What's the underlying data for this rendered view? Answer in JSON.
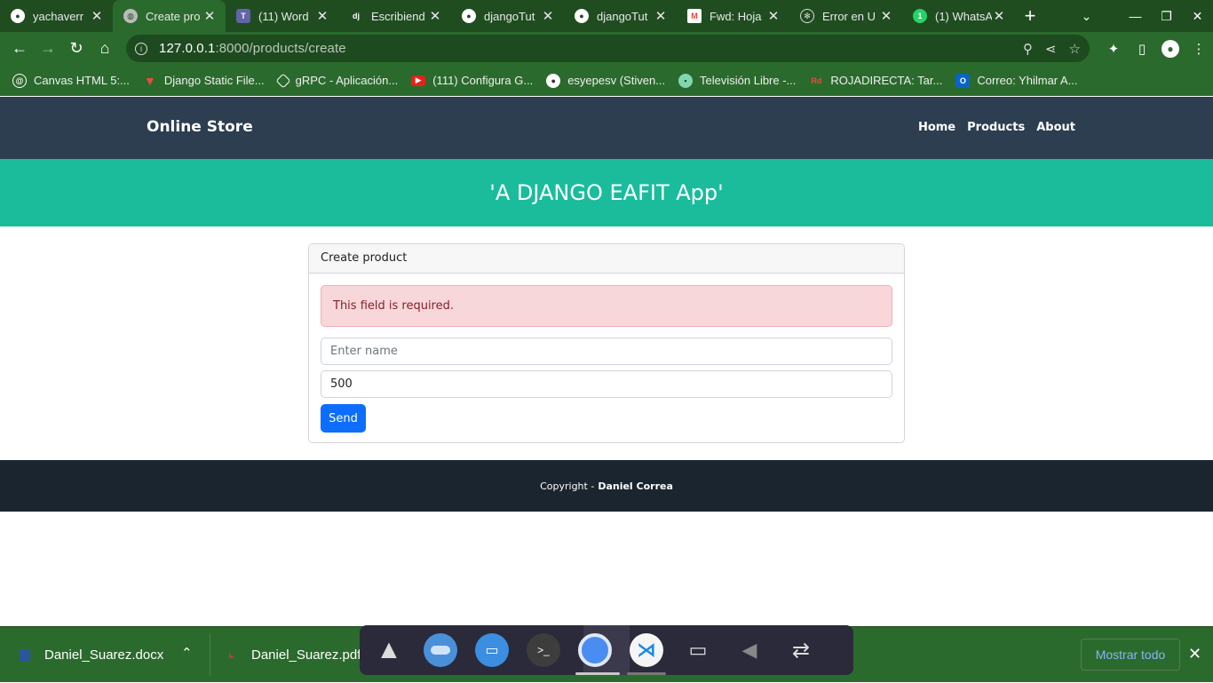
{
  "browser": {
    "tabs": [
      {
        "title": "yachaverr",
        "favicon": "github-icon",
        "active": false
      },
      {
        "title": "Create pro",
        "favicon": "globe-icon",
        "active": true
      },
      {
        "title": "(11) Word",
        "favicon": "teams-icon",
        "active": false
      },
      {
        "title": "Escribiend",
        "favicon": "django-icon",
        "active": false
      },
      {
        "title": "djangoTut",
        "favicon": "github-icon",
        "active": false
      },
      {
        "title": "djangoTut",
        "favicon": "github-icon",
        "active": false
      },
      {
        "title": "Fwd: Hoja",
        "favicon": "gmail-icon",
        "active": false
      },
      {
        "title": "Error en U",
        "favicon": "chatgpt-icon",
        "active": false
      },
      {
        "title": "(1) WhatsA",
        "favicon": "whatsapp-icon",
        "active": false
      }
    ],
    "url_host": "127.0.0.1",
    "url_rest": ":8000/products/create",
    "bookmarks": [
      {
        "label": "Canvas HTML 5:...",
        "icon": "canvas-icon",
        "color": "#444444"
      },
      {
        "label": "Django Static File...",
        "icon": "vivaldi-icon",
        "color": "#c0392b"
      },
      {
        "label": "gRPC - Aplicación...",
        "icon": "grpc-icon",
        "color": "#555555"
      },
      {
        "label": "(111) Configura G...",
        "icon": "youtube-icon",
        "color": "#e62117"
      },
      {
        "label": "esyepesv (Stiven...",
        "icon": "github-icon",
        "color": "#333333"
      },
      {
        "label": "Televisión Libre -...",
        "icon": "tv-icon",
        "color": "#27ae60"
      },
      {
        "label": "ROJADIRECTA: Tar...",
        "icon": "rojadirecta-icon",
        "color": "#c0392b"
      },
      {
        "label": "Correo: Yhilmar A...",
        "icon": "outlook-icon",
        "color": "#0a64c8"
      }
    ]
  },
  "site": {
    "brand": "Online Store",
    "nav": [
      "Home",
      "Products",
      "About"
    ],
    "hero_title": "'A DJANGO EAFIT App'",
    "form": {
      "header": "Create product",
      "error": "This field is required.",
      "name_placeholder": "Enter name",
      "price_value": "500",
      "submit": "Send"
    },
    "footer_prefix": "Copyright -",
    "footer_author": "Daniel Correa"
  },
  "downloads": {
    "items": [
      "Daniel_Suarez.docx",
      "Daniel_Suarez.pdf"
    ],
    "show_all": "Mostrar todo"
  },
  "dock": {
    "apps": [
      "arch-icon",
      "toggle-icon",
      "files-icon",
      "terminal-icon",
      "chrome-icon",
      "vscode-icon",
      "battery-icon",
      "volume-icon",
      "network-icon"
    ]
  }
}
